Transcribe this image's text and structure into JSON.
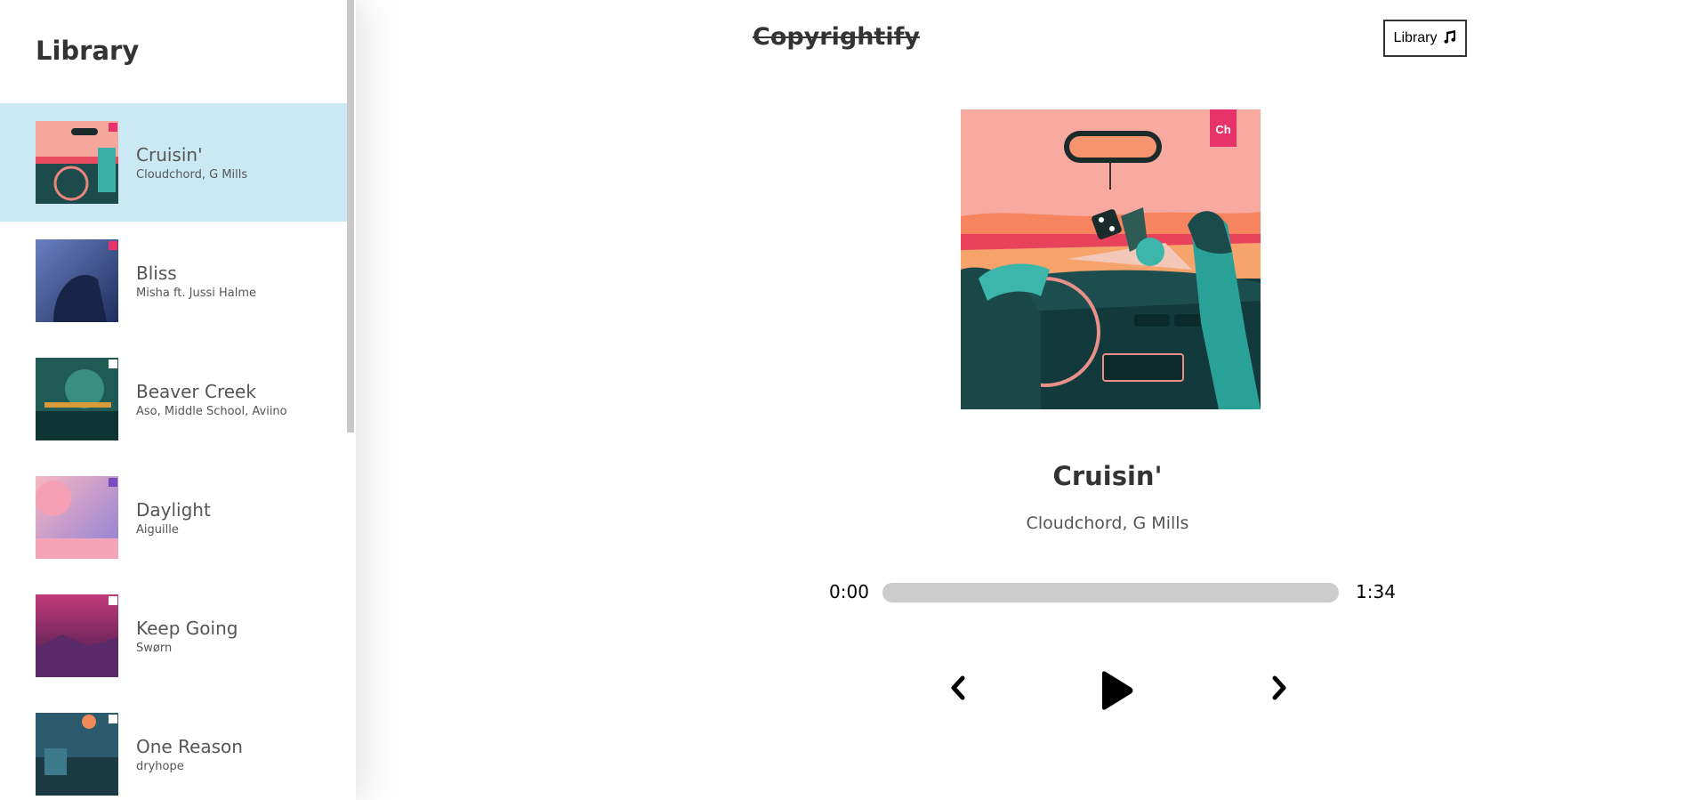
{
  "sidebar": {
    "title": "Library",
    "songs": [
      {
        "title": "Cruisin'",
        "artist": "Cloudchord, G Mills",
        "active": true
      },
      {
        "title": "Bliss",
        "artist": "Misha ft. Jussi Halme",
        "active": false
      },
      {
        "title": "Beaver Creek",
        "artist": "Aso, Middle School, Aviino",
        "active": false
      },
      {
        "title": "Daylight",
        "artist": "Aiguille",
        "active": false
      },
      {
        "title": "Keep Going",
        "artist": "Swørn",
        "active": false
      },
      {
        "title": "One Reason",
        "artist": "dryhope",
        "active": false
      }
    ]
  },
  "header": {
    "brand": "Copyrightify",
    "library_button": "Library",
    "library_icon": "music-note-icon"
  },
  "player": {
    "title": "Cruisin'",
    "artist": "Cloudchord, G Mills",
    "current_time": "0:00",
    "total_time": "1:34",
    "progress": 0,
    "controls": {
      "previous_icon": "chevron-left-icon",
      "play_icon": "play-icon",
      "next_icon": "chevron-right-icon"
    }
  },
  "colors": {
    "active_row": "#cae9f5",
    "track": "#cccccc",
    "text_dark": "#333333"
  }
}
